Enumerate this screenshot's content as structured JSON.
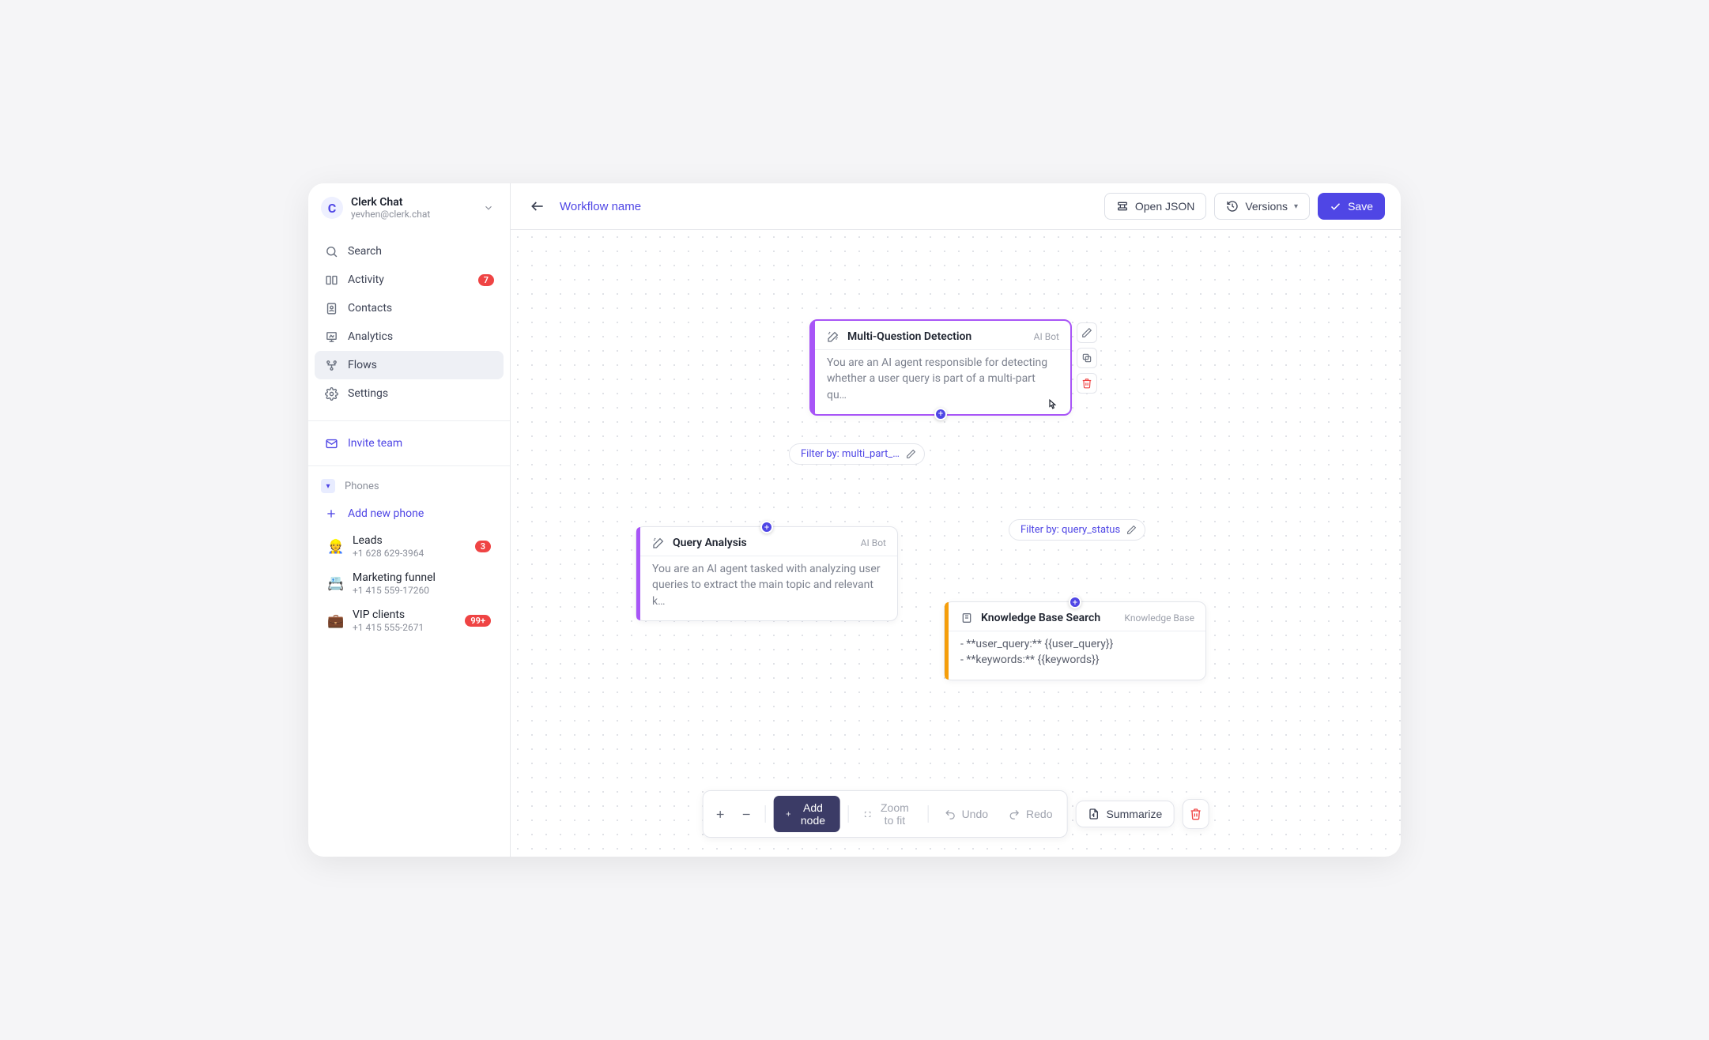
{
  "workspace": {
    "name": "Clerk Chat",
    "email": "yevhen@clerk.chat",
    "logo_letter": "C"
  },
  "nav": {
    "search": "Search",
    "activity": "Activity",
    "activity_badge": "7",
    "contacts": "Contacts",
    "analytics": "Analytics",
    "flows": "Flows",
    "settings": "Settings",
    "invite": "Invite team",
    "phones_header": "Phones",
    "add_phone": "Add new phone"
  },
  "phones": [
    {
      "emoji": "👷",
      "name": "Leads",
      "number": "+1 628 629-3964",
      "badge": "3"
    },
    {
      "emoji": "📇",
      "name": "Marketing funnel",
      "number": "+1 415 559-17260",
      "badge": ""
    },
    {
      "emoji": "💼",
      "name": "VIP clients",
      "number": "+1 415 555-2671",
      "badge": "99+"
    }
  ],
  "topbar": {
    "workflow_name": "Workflow name",
    "open_json": "Open JSON",
    "versions": "Versions",
    "save": "Save"
  },
  "nodes": {
    "n1": {
      "title": "Multi-Question Detection",
      "tag": "AI Bot",
      "body": "You are an AI agent responsible for detecting whether a user query is part of a multi-part qu…",
      "accent": "#a855f7"
    },
    "n2": {
      "title": "Query Analysis",
      "tag": "AI Bot",
      "body": "You are an AI agent tasked with analyzing user queries to extract the main topic and relevant k…",
      "accent": "#a855f7"
    },
    "n3": {
      "title": "Knowledge Base Search",
      "tag": "Knowledge Base",
      "body": "- **user_query:** {{user_query}}\n- **keywords:** {{keywords}}",
      "accent": "#f59e0b"
    }
  },
  "filters": {
    "f1": "Filter by: multi_part_…",
    "f2": "Filter by: query_status"
  },
  "bottom": {
    "add_node": "Add node",
    "zoom": "Zoom to fit",
    "undo": "Undo",
    "redo": "Redo",
    "summarize": "Summarize"
  }
}
